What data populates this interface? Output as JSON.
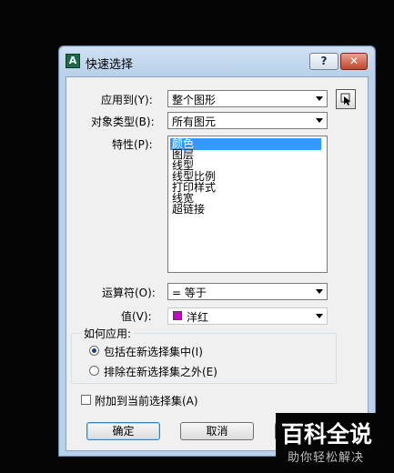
{
  "dialog": {
    "title": "快速选择",
    "app_icon_glyph": "A",
    "help_label": "?",
    "close_label": "✕"
  },
  "apply_to": {
    "label": "应用到(Y):",
    "value": "整个图形"
  },
  "object_type": {
    "label": "对象类型(B):",
    "value": "所有图元"
  },
  "properties": {
    "label": "特性(P):",
    "items": [
      "颜色",
      "图层",
      "线型",
      "线型比例",
      "打印样式",
      "线宽",
      "超链接"
    ],
    "selected_index": 0
  },
  "operator": {
    "label": "运算符(O):",
    "value": "= 等于"
  },
  "value": {
    "label": "值(V):",
    "value": "洋红",
    "swatch_color": "#cc00cc"
  },
  "how_to_apply": {
    "label": "如何应用:",
    "options": [
      {
        "label": "包括在新选择集中(I)",
        "selected": true
      },
      {
        "label": "排除在新选择集之外(E)",
        "selected": false
      }
    ]
  },
  "append": {
    "label": "附加到当前选择集(A)",
    "checked": false
  },
  "buttons": {
    "ok": "确定",
    "cancel": "取消"
  },
  "watermark": {
    "main": "百科全说",
    "sub": "助你轻松解决"
  }
}
